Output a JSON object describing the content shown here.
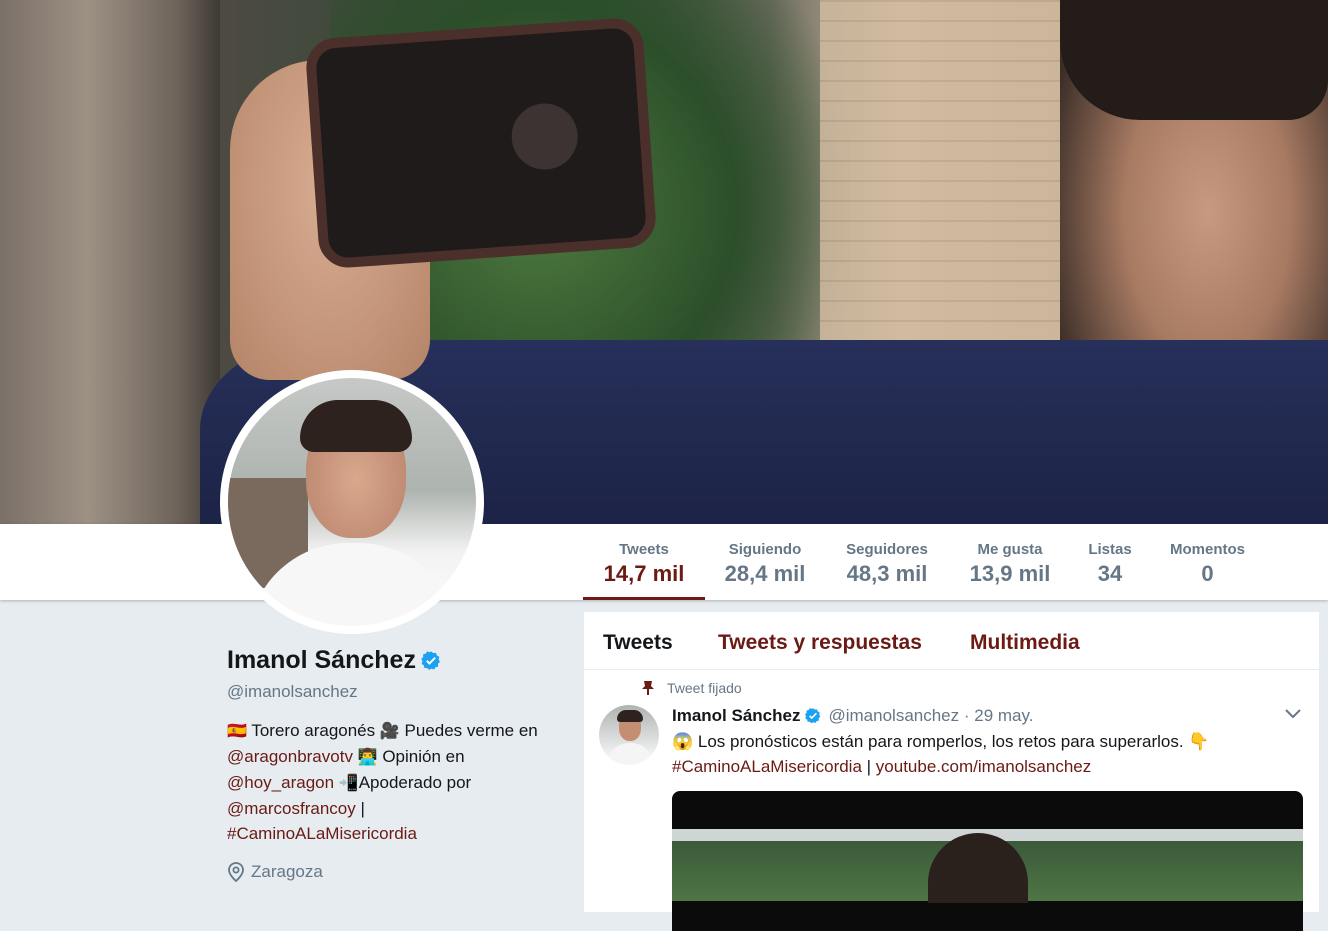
{
  "profile": {
    "name": "Imanol Sánchez",
    "handle": "@imanolsanchez",
    "bio": {
      "flag": "🇪🇸",
      "t1": " Torero aragonés ",
      "camera": "🎥",
      "t2": " Puedes verme en ",
      "link1": "@aragonbravotv",
      "person": "👨‍💻",
      "t3": " Opinión en ",
      "link2": "@hoy_aragon",
      "phone": "📲",
      "t4": "Apoderado por ",
      "link3": "@marcosfrancoy",
      "t5": " | ",
      "link4": "#CaminoALaMisericordia"
    },
    "location": "Zaragoza"
  },
  "stats": [
    {
      "label": "Tweets",
      "value": "14,7 mil"
    },
    {
      "label": "Siguiendo",
      "value": "28,4 mil"
    },
    {
      "label": "Seguidores",
      "value": "48,3 mil"
    },
    {
      "label": "Me gusta",
      "value": "13,9 mil"
    },
    {
      "label": "Listas",
      "value": "34"
    },
    {
      "label": "Momentos",
      "value": "0"
    }
  ],
  "tabs": [
    "Tweets",
    "Tweets y respuestas",
    "Multimedia"
  ],
  "tweet": {
    "pinned_label": "Tweet fijado",
    "name": "Imanol Sánchez",
    "handle_date": "@imanolsanchez · 29 may.",
    "emoji_start": "😱",
    "text": " Los pronósticos están para romperlos, los retos para superarlos. ",
    "emoji_end": "👇",
    "hashtag": "#CaminoALaMisericordia",
    "sep": " | ",
    "link": "youtube.com/imanolsanchez"
  },
  "colors": {
    "accent": "#6b1a14",
    "verified": "#1da1f2",
    "secondary_text": "#657786",
    "background": "#e6ecf0"
  },
  "icons": [
    "verified-badge-icon",
    "location-pin-icon",
    "pin-icon",
    "chevron-down-icon"
  ]
}
